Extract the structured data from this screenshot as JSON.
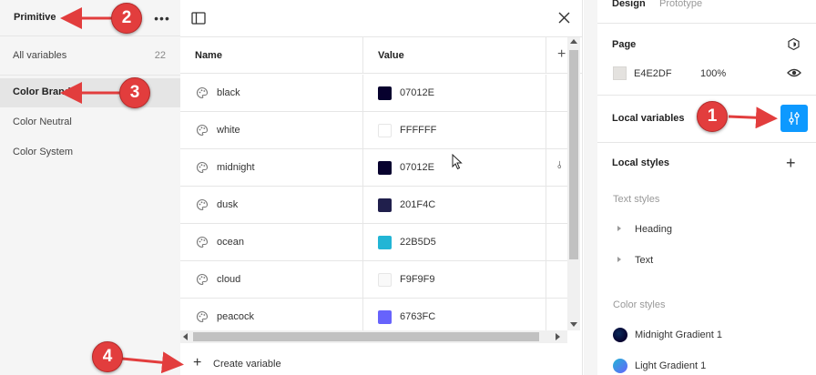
{
  "collections": {
    "title": "Primitive",
    "more_icon": "more-horizontal-icon",
    "all_variables": {
      "label": "All variables",
      "count": "22"
    },
    "groups": [
      {
        "label": "Color Brand",
        "active": true
      },
      {
        "label": "Color Neutral",
        "active": false
      },
      {
        "label": "Color System",
        "active": false
      }
    ]
  },
  "table": {
    "headers": {
      "name": "Name",
      "value": "Value"
    },
    "rows": [
      {
        "name": "black",
        "hex": "07012E",
        "color": "#07012e"
      },
      {
        "name": "white",
        "hex": "FFFFFF",
        "color": "#ffffff"
      },
      {
        "name": "midnight",
        "hex": "07012E",
        "color": "#07012e"
      },
      {
        "name": "dusk",
        "hex": "201F4C",
        "color": "#201f4c"
      },
      {
        "name": "ocean",
        "hex": "22B5D5",
        "color": "#22b5d5"
      },
      {
        "name": "cloud",
        "hex": "F9F9F9",
        "color": "#f9f9f9"
      },
      {
        "name": "peacock",
        "hex": "6763FC",
        "color": "#6763fc"
      }
    ],
    "create_label": "Create variable"
  },
  "design_panel": {
    "tabs": [
      "Design",
      "Prototype"
    ],
    "page": {
      "title": "Page",
      "hex": "E4E2DF",
      "opacity": "100%"
    },
    "local_variables": "Local variables",
    "local_styles": "Local styles",
    "text_styles": {
      "title": "Text styles",
      "items": [
        "Heading",
        "Text"
      ]
    },
    "color_styles": {
      "title": "Color styles",
      "items": [
        {
          "label": "Midnight Gradient 1"
        },
        {
          "label": "Light Gradient 1"
        }
      ]
    }
  },
  "annotations": [
    "1",
    "2",
    "3",
    "4"
  ],
  "colors": {
    "accent": "#0d99ff",
    "annotation": "#e23d3d"
  }
}
